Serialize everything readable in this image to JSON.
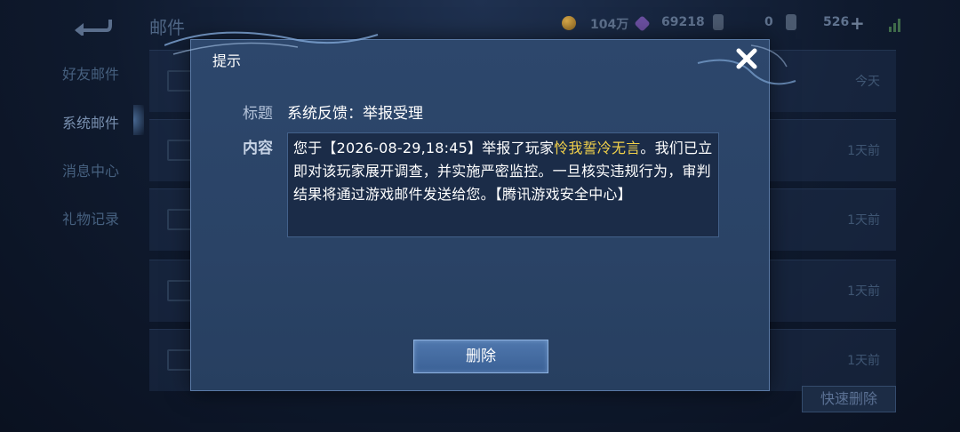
{
  "topbar": {
    "title": "邮件",
    "coins": "104万",
    "gems": "69218",
    "tickets": "0",
    "diamonds": "526"
  },
  "sidebar": {
    "items": [
      {
        "label": "好友邮件"
      },
      {
        "label": "系统邮件"
      },
      {
        "label": "消息中心"
      },
      {
        "label": "礼物记录"
      }
    ]
  },
  "mail_list": {
    "rows": [
      {
        "time": "今天"
      },
      {
        "time": "1天前"
      },
      {
        "time": "1天前"
      },
      {
        "time": "1天前"
      },
      {
        "time": "1天前"
      }
    ],
    "quick_delete_label": "快速删除"
  },
  "dialog": {
    "title": "提示",
    "title_label": "标题",
    "title_value": "系统反馈：举报受理",
    "content_label": "内容",
    "content_before": "您于【2026-08-29,18:45】举报了玩家",
    "player_name": "怜我誓冷无言",
    "content_after": "。我们已立即对该玩家展开调查，并实施严密监控。一旦核实违规行为，审判结果将通过游戏邮件发送给您。【腾讯游戏安全中心】",
    "delete_label": "删除"
  },
  "colors": {
    "player_name": "#f3d24a",
    "dialog_bg": "#2d476c",
    "button_bg": "#4f77ad"
  }
}
